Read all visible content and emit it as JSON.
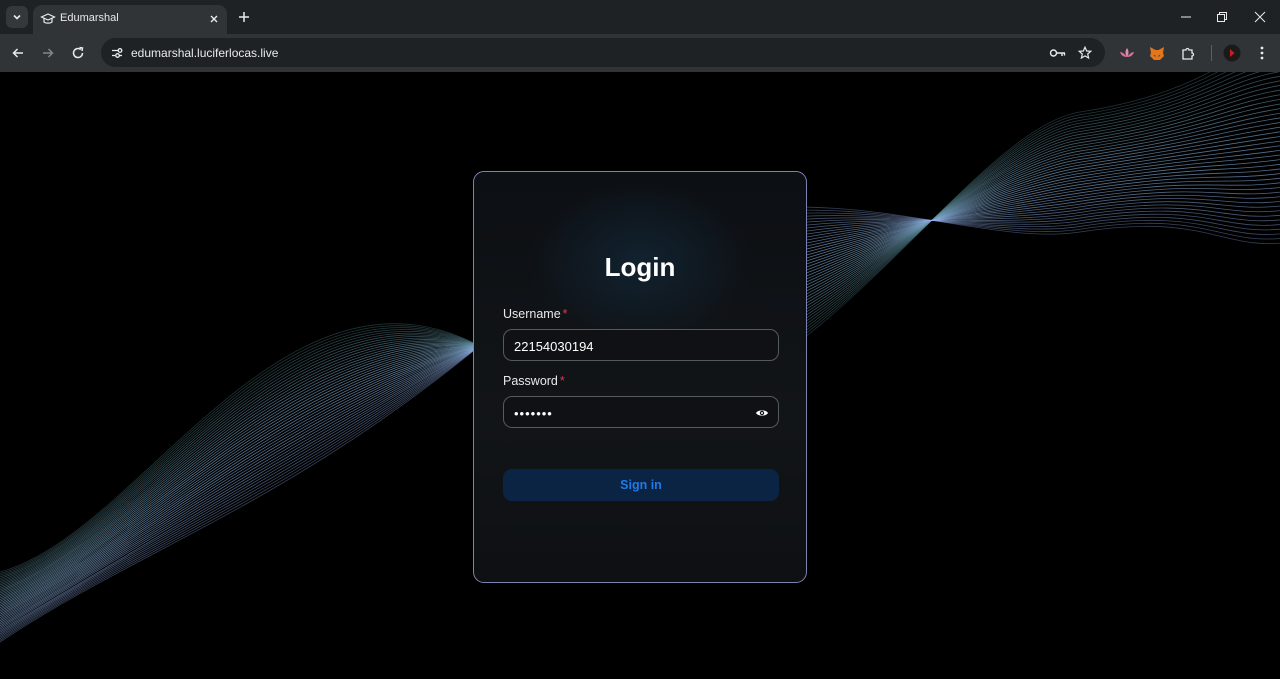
{
  "browser": {
    "tab_title": "Edumarshal",
    "url": "edumarshal.luciferlocas.live"
  },
  "login": {
    "title": "Login",
    "username_label": "Username",
    "username_value": "22154030194",
    "password_label": "Password",
    "password_value": "•••••••",
    "required_marker": "*",
    "signin_label": "Sign in"
  },
  "colors": {
    "card_border": "#7d82b4",
    "button_bg": "#0c2444",
    "button_text": "#1f7ae6",
    "required": "#e0374f"
  }
}
